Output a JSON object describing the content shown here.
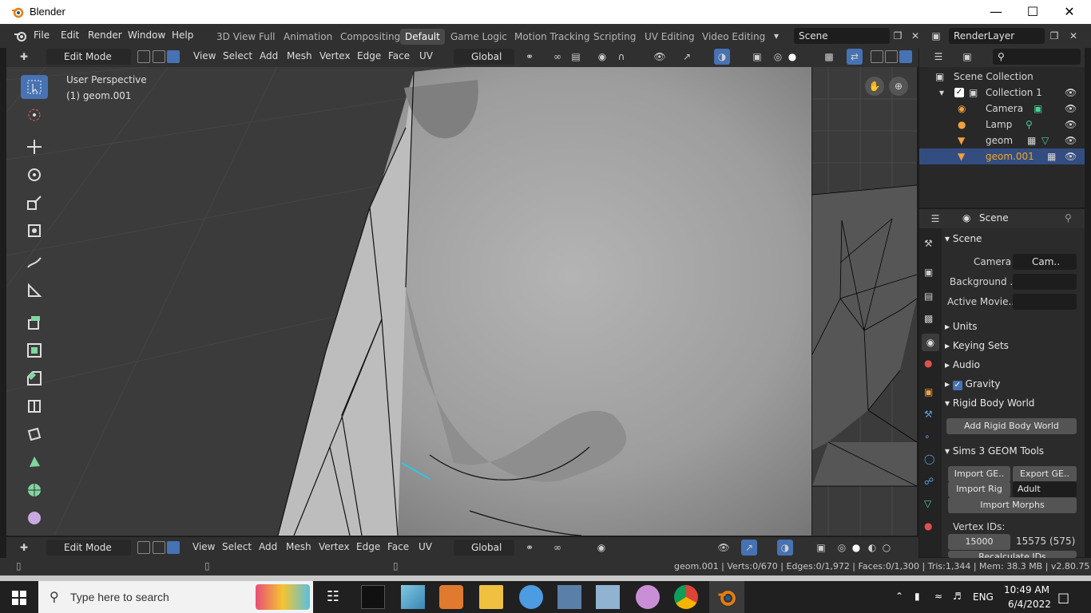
{
  "window": {
    "title": "Blender"
  },
  "menus": [
    "File",
    "Edit",
    "Render",
    "Window",
    "Help"
  ],
  "workspaces": [
    "3D View Full",
    "Animation",
    "Compositing",
    "Default",
    "Game Logic",
    "Motion Tracking",
    "Scripting",
    "UV Editing",
    "Video Editing"
  ],
  "active_workspace": "Default",
  "scene_field": "Scene",
  "renderlayer_field": "RenderLayer",
  "viewport": {
    "mode": "Edit Mode",
    "menus": [
      "View",
      "Select",
      "Add",
      "Mesh",
      "Vertex",
      "Edge",
      "Face",
      "UV"
    ],
    "orientation": "Global",
    "overlay_line1": "User Perspective",
    "overlay_line2": "(1) geom.001"
  },
  "outliner": {
    "root": "Scene Collection",
    "collection": "Collection 1",
    "items": [
      "Camera",
      "Lamp",
      "geom",
      "geom.001"
    ],
    "selected": "geom.001"
  },
  "properties": {
    "context": "Scene",
    "section_scene": "Scene",
    "camera_label": "Camera",
    "camera_value": "Cam..",
    "background_label": "Background ..",
    "active_movie_label": "Active Movie..",
    "panels_collapsed": [
      "Units",
      "Keying Sets",
      "Audio"
    ],
    "gravity": "Gravity",
    "rigid_body": "Rigid Body World",
    "add_rigid_body_button": "Add Rigid Body World",
    "sims_panel": "Sims 3 GEOM Tools",
    "import_geom": "Import GE..",
    "export_geom": "Export GE..",
    "import_rig": "Import Rig",
    "rig_option": "Adult",
    "import_morphs": "Import Morphs",
    "vertex_ids_label": "Vertex IDs:",
    "vertex_id_start": "15000",
    "vertex_id_end": "15575 (575)",
    "recalc": "Recalculate IDs"
  },
  "status": "geom.001 | Verts:0/670 | Edges:0/1,972 | Faces:0/1,300 | Tris:1,344 | Mem: 38.3 MB | v2.80.75",
  "taskbar": {
    "search_placeholder": "Type here to search",
    "language": "ENG",
    "time": "10:49 AM",
    "date": "6/4/2022"
  },
  "colors": {
    "accent": "#4772b3",
    "header": "#303030",
    "viewport_bg": "#3d3d3d",
    "selected_text": "#f5a623"
  }
}
